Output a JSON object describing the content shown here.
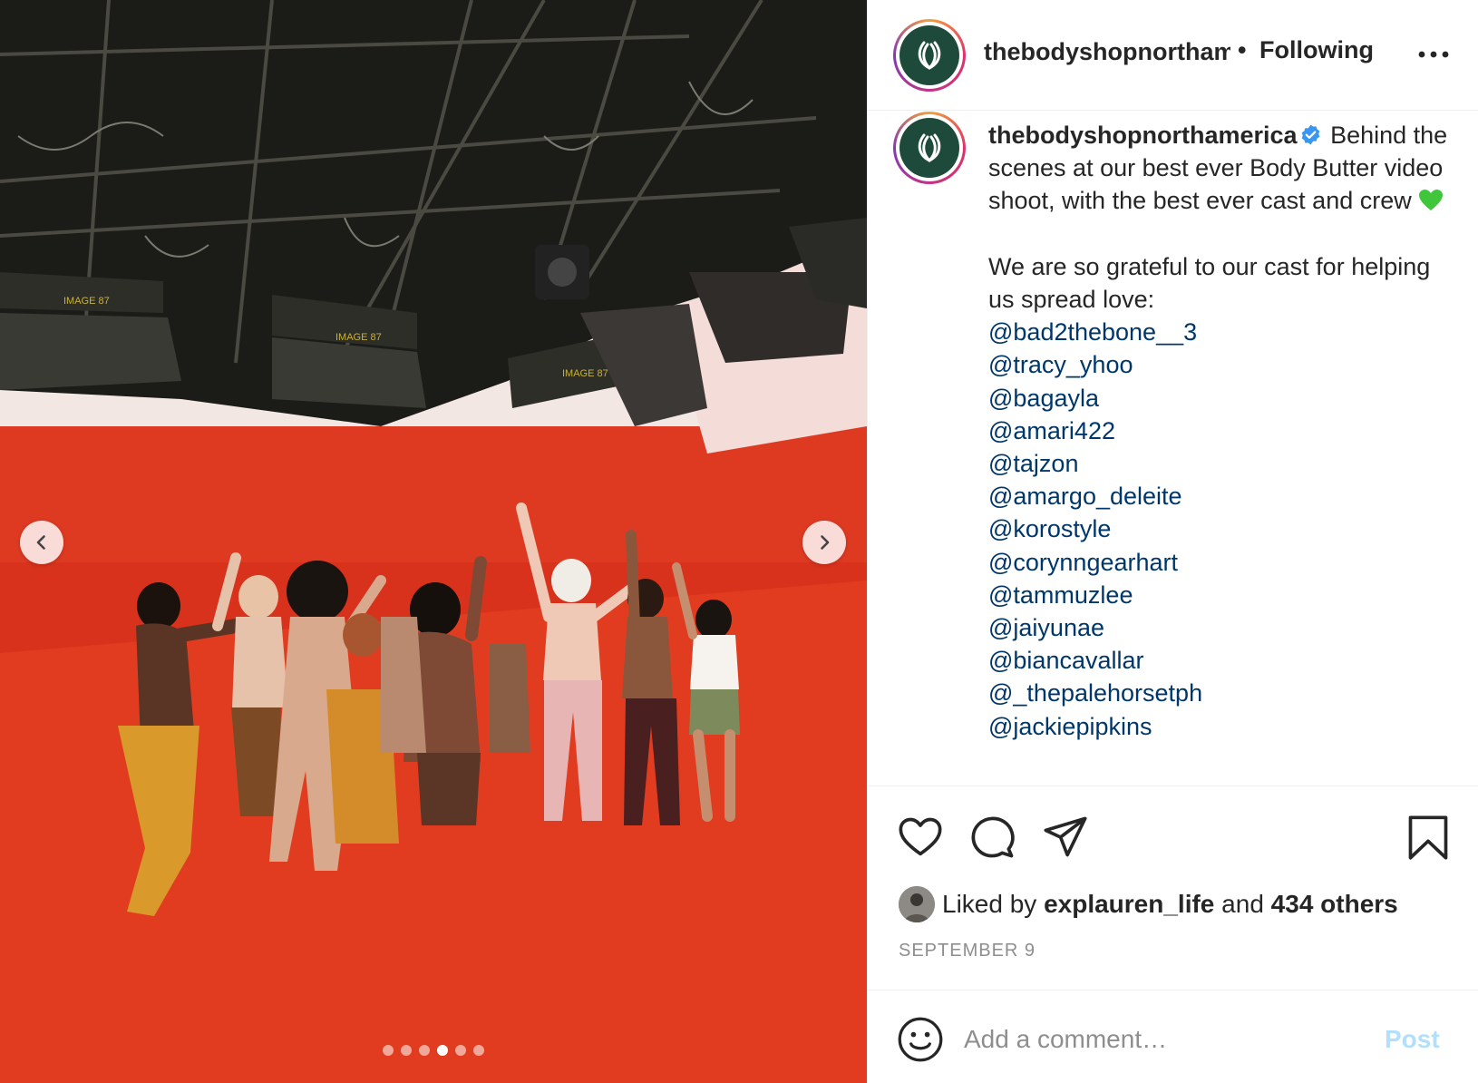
{
  "post": {
    "media": {
      "description_icon": "photo",
      "slide_count": 6,
      "active_slide": 4,
      "prev_arrow_icon": "chevron-left-icon",
      "next_arrow_icon": "chevron-right-icon"
    },
    "header": {
      "username": "thebodyshopnorthamerica",
      "separator": "•",
      "follow_status": "Following",
      "more_icon": "more-horizontal-icon"
    },
    "caption": {
      "username": "thebodyshopnorthamerica",
      "verified": true,
      "text_line1": "Behind the scenes at our best ever Body Butter video shoot, with the best ever cast and crew",
      "emoji": "green-heart",
      "text_line2": "We are so grateful to our cast for helping us spread love:",
      "mentions": [
        "@bad2thebone__3",
        "@tracy_yhoo",
        "@bagayla",
        "@amari422",
        "@tajzon",
        "@amargo_deleite",
        "@korostyle",
        "@corynngearhart",
        "@tammuzlee",
        "@jaiyunae",
        "@biancavallar",
        "@_thepalehorsetph",
        "@jackiepipkins"
      ]
    },
    "actions": {
      "like_icon": "heart-icon",
      "comment_icon": "comment-icon",
      "share_icon": "paper-plane-icon",
      "save_icon": "bookmark-icon"
    },
    "likes": {
      "prefix": "Liked by",
      "user": "explauren_life",
      "conjunction": "and",
      "others": "434 others"
    },
    "date": "SEPTEMBER 9",
    "comment": {
      "placeholder": "Add a comment…",
      "post_label": "Post",
      "emoji_icon": "smiley-icon"
    },
    "colors": {
      "accent_link": "#00376b",
      "post_button_disabled": "#b2dffc",
      "brand_green": "#1d4a3a",
      "backdrop_red": "#d8321c"
    }
  }
}
